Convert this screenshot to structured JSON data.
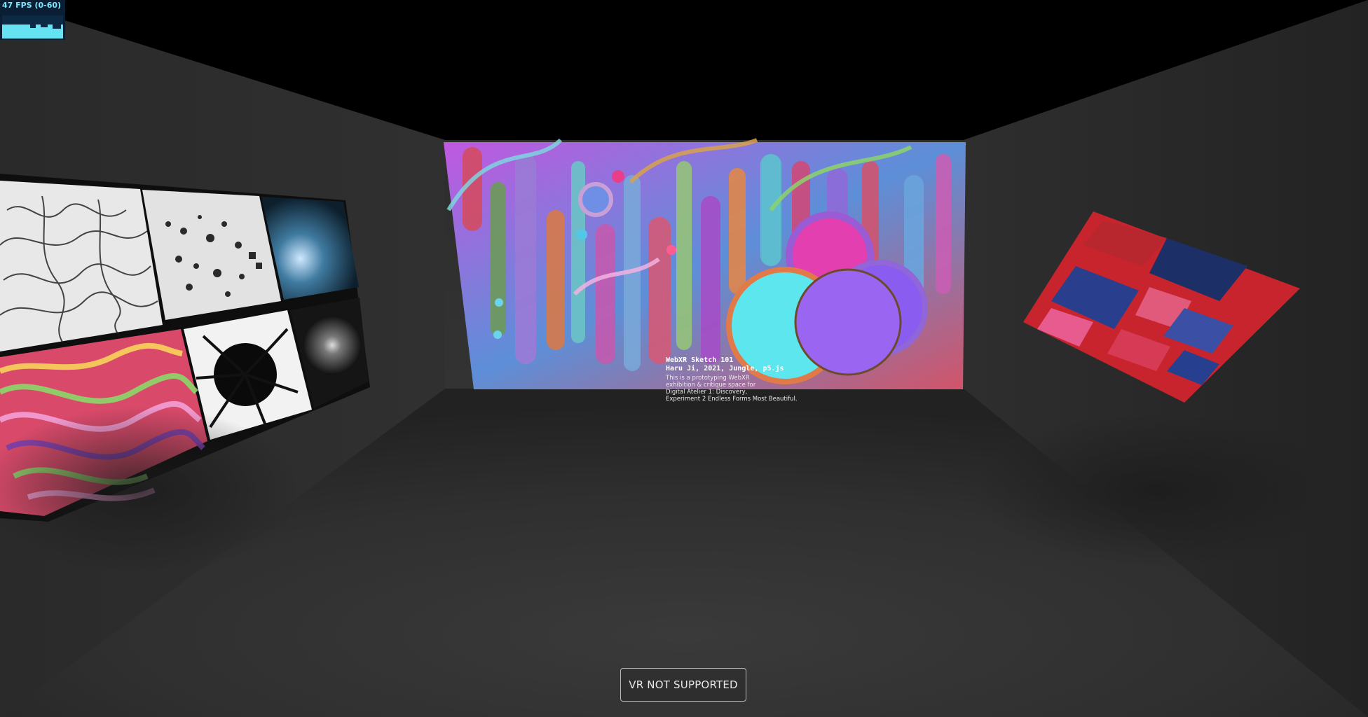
{
  "stats": {
    "fps_label": "47 FPS (0-60)"
  },
  "vr_button": {
    "label": "VR NOT SUPPORTED"
  },
  "artwork": {
    "title": "WebXR Sketch 101",
    "credit": "Haru Ji, 2021, Jungle, p5.js",
    "description_lines": [
      "This is a prototyping WebXR",
      "exhibition & critique space for",
      "Digital Atelier 1: Discovery,",
      "Experiment 2 Endless Forms Most Beautiful."
    ]
  },
  "colors": {
    "fps_text": "#7fe6ff",
    "fps_graph": "#66e3f2",
    "room_ceiling": "#000000",
    "room_floor": "#333333"
  }
}
